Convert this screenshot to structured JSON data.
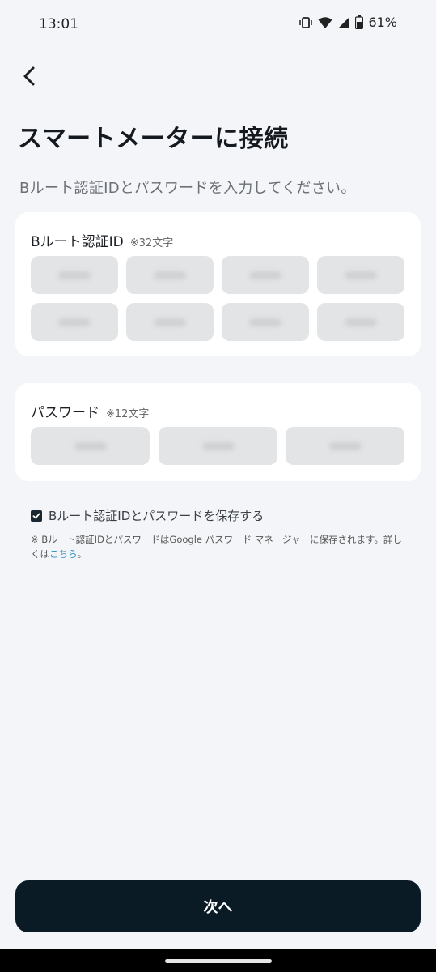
{
  "status": {
    "time": "13:01",
    "battery": "61%"
  },
  "header": {
    "title": "スマートメーターに接続",
    "subtitle": "Bルート認証IDとパスワードを入力してください。"
  },
  "id_section": {
    "label": "Bルート認証ID",
    "note": "※32文字",
    "field_count": 8
  },
  "password_section": {
    "label": "パスワード",
    "note": "※12文字",
    "field_count": 3
  },
  "save": {
    "checked": true,
    "label": "Bルート認証IDとパスワードを保存する",
    "note_text": "※ Bルート認証IDとパスワードはGoogle パスワード マネージャーに保存されます。詳しくは",
    "note_link": "こちら",
    "note_end": "。"
  },
  "next_button": {
    "label": "次へ"
  },
  "colors": {
    "background": "#f4f5f8",
    "primary": "#0b1b26",
    "link": "#2f8fbf",
    "field": "#e3e4e6"
  }
}
